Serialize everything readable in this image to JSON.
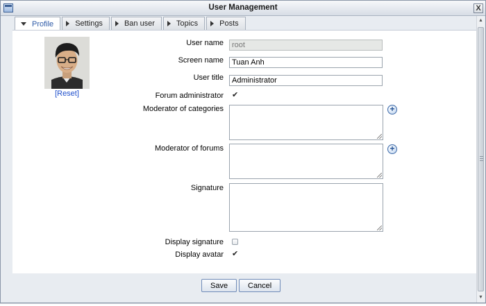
{
  "window": {
    "title": "User Management",
    "close_label": "X"
  },
  "tabs": [
    {
      "label": "Profile",
      "active": true
    },
    {
      "label": "Settings",
      "active": false
    },
    {
      "label": "Ban user",
      "active": false
    },
    {
      "label": "Topics",
      "active": false
    },
    {
      "label": "Posts",
      "active": false
    }
  ],
  "profile": {
    "avatar_reset_label": "[Reset]",
    "user_name_label": "User name",
    "user_name_value": "root",
    "screen_name_label": "Screen name",
    "screen_name_value": "Tuan Anh",
    "user_title_label": "User title",
    "user_title_value": "Administrator",
    "forum_admin_label": "Forum administrator",
    "forum_admin_checked": true,
    "moderator_categories_label": "Moderator of categories",
    "moderator_forums_label": "Moderator of forums",
    "signature_label": "Signature",
    "display_signature_label": "Display signature",
    "display_signature_checked": false,
    "display_avatar_label": "Display avatar",
    "display_avatar_checked": true,
    "check_glyph": "✔"
  },
  "footer": {
    "save_label": "Save",
    "cancel_label": "Cancel"
  },
  "colors": {
    "link": "#1f4fcc",
    "active_tab_text": "#2e5ba8",
    "title_bar": "#d7dde6"
  }
}
